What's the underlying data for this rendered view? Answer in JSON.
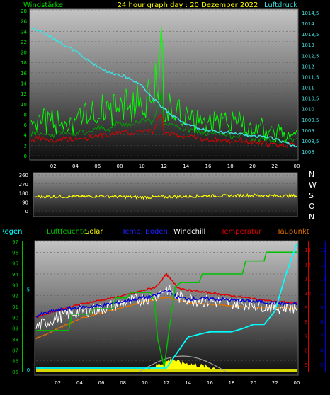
{
  "header": {
    "left_label": "Windstärke",
    "title": "24 hour graph day : 20 Dezember 2022",
    "right_label": "Luftdruck"
  },
  "colors": {
    "wind": "#00e000",
    "gust": "#00ff00",
    "wind_red": "#e00000",
    "pressure": "#40e0e0",
    "direction": "#ffff00",
    "humidity": "#00c000",
    "regen": "#00ffff",
    "solar": "#ffff00",
    "temp_boden": "#0000e0",
    "windchill": "#ffffff",
    "temperatur": "#e00000",
    "taupunkt": "#e07000",
    "grey_line": "#a0a0a0"
  },
  "chart_data": [
    {
      "type": "line",
      "title": "24 hour graph day : 20 Dezember 2022",
      "x_ticks": [
        "02",
        "04",
        "06",
        "08",
        "10",
        "12",
        "14",
        "16",
        "18",
        "20",
        "22",
        "00"
      ],
      "left_axis": {
        "label": "Windstärke",
        "ticks": [
          "28",
          "26",
          "24",
          "22",
          "20",
          "18",
          "16",
          "14",
          "12",
          "10",
          "8",
          "6",
          "4",
          "2",
          "0"
        ],
        "ylim": [
          0,
          28
        ]
      },
      "right_axis": {
        "label": "Luftdruck",
        "ticks": [
          "1014,5",
          "1014",
          "1013,5",
          "1013",
          "1012,5",
          "1012",
          "1011,5",
          "1011",
          "1010,5",
          "1010",
          "1009,5",
          "1009",
          "1008,5",
          "1008"
        ],
        "ylim": [
          1007.8,
          1014.6
        ]
      },
      "series": [
        {
          "name": "Windstärke",
          "hours": [
            0,
            1,
            2,
            3,
            4,
            5,
            6,
            7,
            8,
            9,
            10,
            11,
            11.8,
            12,
            13,
            14,
            15,
            16,
            17,
            18,
            19,
            20,
            21,
            22,
            23,
            24
          ],
          "values": [
            8,
            9,
            7,
            9,
            8,
            9,
            11,
            10,
            13,
            12,
            14,
            13,
            26,
            12,
            11,
            10,
            9,
            8,
            8,
            7,
            8,
            6,
            6,
            5,
            5,
            5
          ]
        },
        {
          "name": "Luftdruck",
          "hours": [
            0,
            1,
            2,
            3,
            4,
            5,
            6,
            7,
            8,
            9,
            10,
            11,
            12,
            13,
            14,
            15,
            16,
            17,
            18,
            19,
            20,
            21,
            22,
            23,
            24
          ],
          "values": [
            1013.8,
            1013.6,
            1013.3,
            1013.0,
            1012.7,
            1012.3,
            1012.0,
            1011.7,
            1011.6,
            1011.4,
            1011.1,
            1010.5,
            1010.0,
            1009.6,
            1009.3,
            1009.1,
            1009.0,
            1008.9,
            1008.9,
            1008.8,
            1008.7,
            1008.7,
            1008.6,
            1008.4,
            1008.2
          ]
        }
      ]
    },
    {
      "type": "line",
      "left_axis": {
        "ticks": [
          "360",
          "270",
          "180",
          "90",
          "0"
        ],
        "ylim": [
          0,
          360
        ]
      },
      "right_axis": {
        "ticks": [
          "N",
          "W",
          "S",
          "O",
          "N"
        ]
      },
      "series": [
        {
          "name": "Windrichtung",
          "hours": [
            0,
            2,
            4,
            6,
            8,
            10,
            12,
            14,
            16,
            18,
            20,
            22,
            24
          ],
          "values": [
            140,
            145,
            140,
            150,
            140,
            135,
            140,
            145,
            150,
            150,
            155,
            150,
            150
          ]
        }
      ]
    },
    {
      "type": "line",
      "legend": [
        "Regen",
        "Luftfeuchte",
        "Solar",
        "Temp. Boden",
        "Windchill",
        "Temperatur",
        "Taupunkt"
      ],
      "x_ticks": [
        "02",
        "04",
        "06",
        "08",
        "10",
        "12",
        "14",
        "16",
        "18",
        "20",
        "22",
        "00"
      ],
      "humidity_axis": {
        "ticks": [
          "97",
          "96",
          "95",
          "94",
          "93",
          "92",
          "91",
          "90",
          "89",
          "88",
          "87",
          "86",
          "85"
        ],
        "ylim": [
          85,
          97
        ]
      },
      "regen_axis": {
        "ticks": [
          "5",
          "0"
        ]
      },
      "temp_axis": {
        "ticks": [
          "13",
          "12",
          "11",
          "10",
          "9",
          "8",
          "7",
          "6",
          "5"
        ],
        "ylim": [
          4.5,
          13.6
        ]
      },
      "series": [
        {
          "name": "Luftfeuchte",
          "hours": [
            0,
            3,
            3.3,
            5,
            5.3,
            7,
            7.3,
            8.4,
            8.7,
            10.5,
            10.9,
            11.2,
            11.8,
            12.2,
            12.8,
            13.3,
            15,
            15.3,
            19,
            19.3,
            21,
            21.2,
            24
          ],
          "values": [
            88.8,
            88.8,
            90.3,
            90.3,
            90.8,
            90.8,
            91.8,
            91.8,
            92.3,
            92.3,
            91.5,
            88,
            85.4,
            88.5,
            92.8,
            93.2,
            93.2,
            94,
            94,
            95.2,
            95.2,
            96,
            96
          ]
        },
        {
          "name": "Regen",
          "hours": [
            0,
            10,
            11,
            12,
            13,
            14,
            16,
            18,
            19,
            20,
            21,
            22,
            23,
            24
          ],
          "values": [
            0,
            0,
            0,
            0,
            1.5,
            3,
            3.5,
            3.5,
            3.8,
            4.2,
            4.2,
            5.5,
            9,
            12
          ]
        },
        {
          "name": "Solar",
          "hours": [
            10,
            11,
            12,
            12.5,
            13,
            14,
            15,
            16,
            17
          ],
          "values": [
            0,
            1,
            2,
            3,
            2,
            1.5,
            1,
            0.5,
            0
          ]
        },
        {
          "name": "Temperatur",
          "hours": [
            0,
            2,
            4,
            6,
            8,
            10,
            11,
            12,
            13,
            14,
            16,
            18,
            20,
            22,
            24
          ],
          "values": [
            8.3,
            8.8,
            9.2,
            9.5,
            9.8,
            10.2,
            10.4,
            11.3,
            10.4,
            10.2,
            10.0,
            9.8,
            9.6,
            9.4,
            9.3
          ]
        },
        {
          "name": "Temp. Boden",
          "hours": [
            0,
            2,
            4,
            6,
            8,
            10,
            11,
            12,
            13,
            14,
            16,
            18,
            20,
            22,
            24
          ],
          "values": [
            8.4,
            8.8,
            9.0,
            9.1,
            9.4,
            9.7,
            9.8,
            10.2,
            9.7,
            9.6,
            9.6,
            9.5,
            9.4,
            9.3,
            9.2
          ]
        },
        {
          "name": "Windchill",
          "hours": [
            0,
            2,
            4,
            6,
            8,
            10,
            11,
            12,
            13,
            14,
            16,
            18,
            20,
            22,
            24
          ],
          "values": [
            7.6,
            8.3,
            8.7,
            8.9,
            9.3,
            9.6,
            9.8,
            10.3,
            9.7,
            9.6,
            9.4,
            9.3,
            9.2,
            9.0,
            9.0
          ]
        },
        {
          "name": "Taupunkt",
          "hours": [
            0,
            2,
            4,
            6,
            8,
            10,
            11,
            12,
            13,
            14,
            16,
            18,
            20,
            22,
            24
          ],
          "values": [
            6.8,
            7.5,
            8.2,
            8.6,
            9.0,
            9.4,
            9.5,
            9.7,
            9.5,
            9.3,
            9.2,
            9.1,
            9.0,
            9.0,
            8.9
          ]
        }
      ]
    }
  ],
  "legend_labels": {
    "regen": "Regen",
    "luftfeuchte": "Luftfeuchte",
    "solar": "Solar",
    "temp_boden": "Temp. Boden",
    "windchill": "Windchill",
    "temperatur": "Temperatur",
    "taupunkt": "Taupunkt"
  }
}
